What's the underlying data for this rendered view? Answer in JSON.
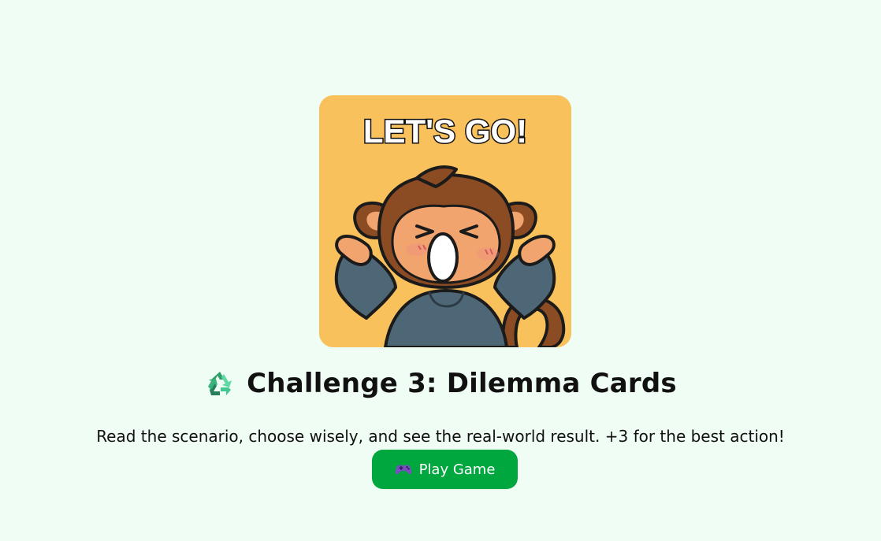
{
  "hero": {
    "animation": {
      "caption": "LET'S GO!",
      "icon": "cheering-monkey-illustration"
    },
    "title": "Challenge 3: Dilemma Cards",
    "title_icon": "recycle-icon",
    "description": "Read the scenario, choose wisely, and see the real-world result. +3 for the best action!",
    "play_button": {
      "label": "Play Game",
      "icon": "gamepad-icon"
    }
  },
  "colors": {
    "page_background": "#f0fdf4",
    "card_background": "#f9c15c",
    "button_background": "#00a63e",
    "button_text": "#ffffff"
  }
}
